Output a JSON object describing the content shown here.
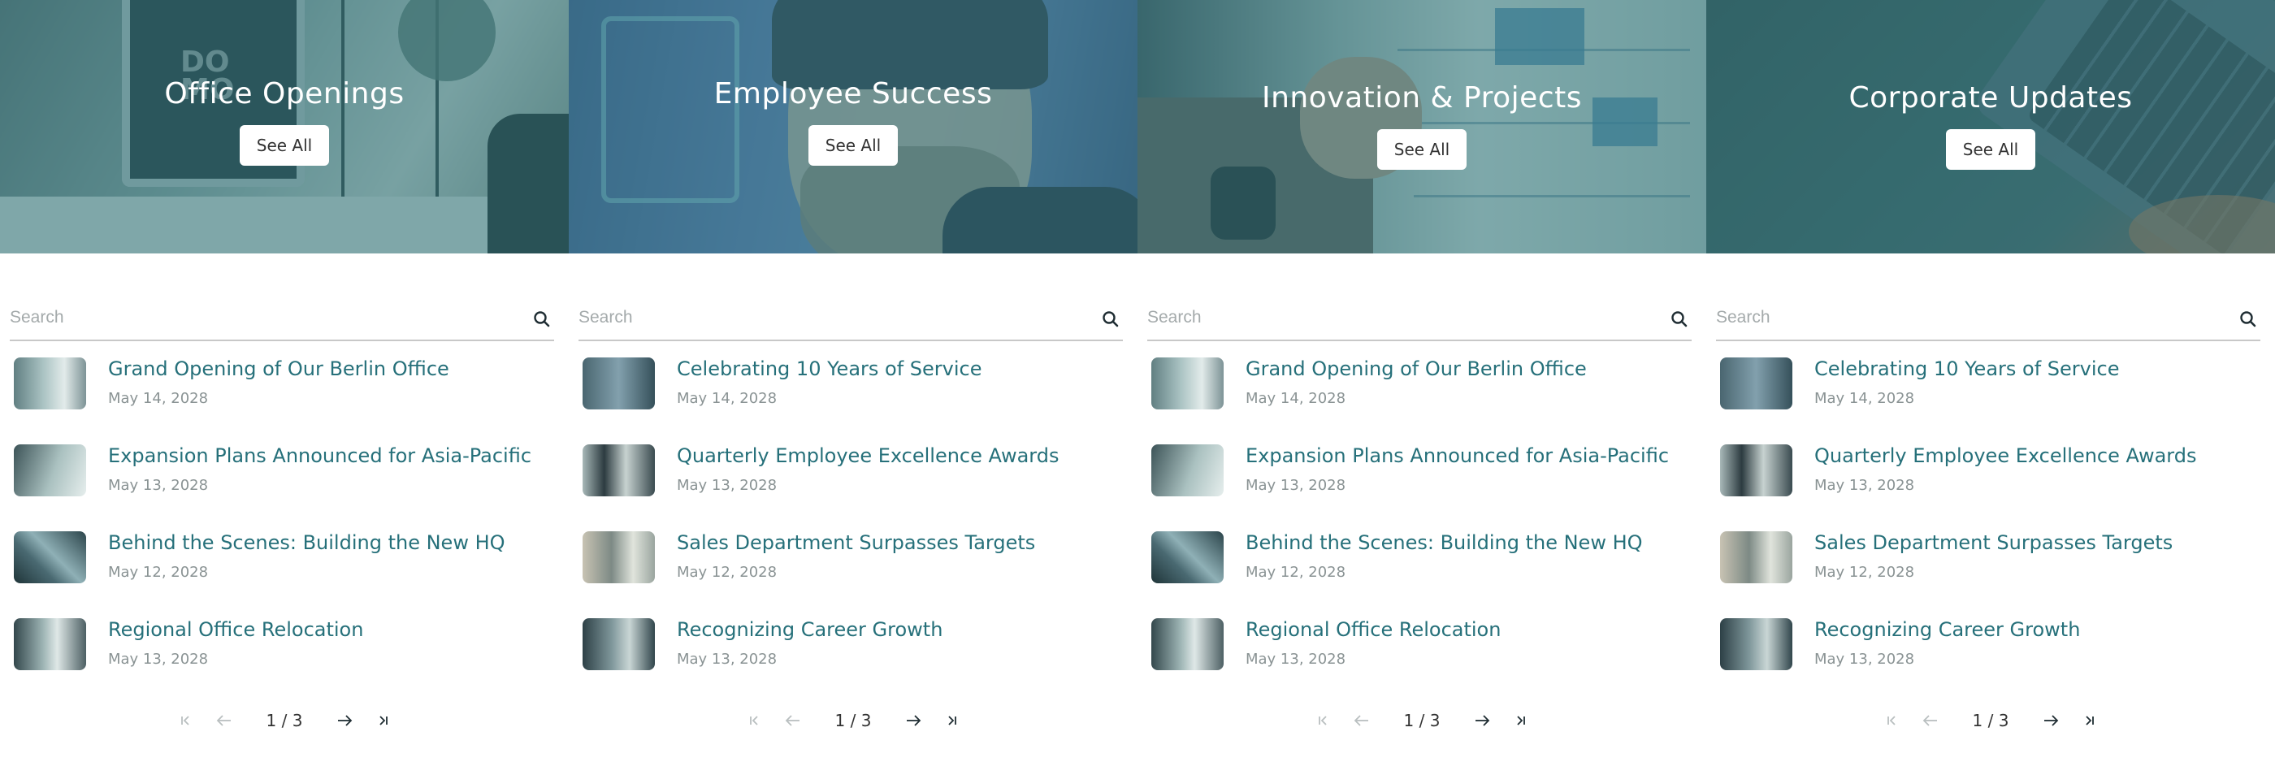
{
  "columns": [
    {
      "hero_title": "Office Openings",
      "see_all_label": "See All",
      "search_placeholder": "Search",
      "articles": [
        {
          "title": "Grand Opening of Our Berlin Office",
          "date": "May 14, 2028"
        },
        {
          "title": "Expansion Plans Announced for Asia-Pacific",
          "date": "May 13, 2028"
        },
        {
          "title": "Behind the Scenes: Building the New HQ",
          "date": "May 12, 2028"
        },
        {
          "title": "Regional Office Relocation",
          "date": "May 13, 2028"
        }
      ],
      "pagination": "1 / 3"
    },
    {
      "hero_title": "Employee Success",
      "see_all_label": "See All",
      "search_placeholder": "Search",
      "articles": [
        {
          "title": "Celebrating 10 Years of Service",
          "date": "May 14, 2028"
        },
        {
          "title": "Quarterly Employee Excellence Awards",
          "date": "May 13, 2028"
        },
        {
          "title": "Sales Department Surpasses Targets",
          "date": "May 12, 2028"
        },
        {
          "title": "Recognizing Career Growth",
          "date": "May 13, 2028"
        }
      ],
      "pagination": "1 / 3"
    },
    {
      "hero_title": "Innovation & Projects",
      "see_all_label": "See All",
      "search_placeholder": "Search",
      "articles": [
        {
          "title": "Grand Opening of Our Berlin Office",
          "date": "May 14, 2028"
        },
        {
          "title": "Expansion Plans Announced for Asia-Pacific",
          "date": "May 13, 2028"
        },
        {
          "title": "Behind the Scenes: Building the New HQ",
          "date": "May 12, 2028"
        },
        {
          "title": "Regional Office Relocation",
          "date": "May 13, 2028"
        }
      ],
      "pagination": "1 / 3"
    },
    {
      "hero_title": "Corporate Updates",
      "see_all_label": "See All",
      "search_placeholder": "Search",
      "articles": [
        {
          "title": "Celebrating 10 Years of Service",
          "date": "May 14, 2028"
        },
        {
          "title": "Quarterly Employee Excellence Awards",
          "date": "May 13, 2028"
        },
        {
          "title": "Sales Department Surpasses Targets",
          "date": "May 12, 2028"
        },
        {
          "title": "Recognizing Career Growth",
          "date": "May 13, 2028"
        }
      ],
      "pagination": "1 / 3"
    }
  ],
  "colors": {
    "accent": "#26707a",
    "hero_tint": "#34787d",
    "date_gray": "#8a9394",
    "placeholder_gray": "#a4aaab"
  },
  "icons": {
    "search": "search-icon",
    "first": "first-page-icon",
    "prev": "arrow-left-icon",
    "next": "arrow-right-icon",
    "last": "last-page-icon"
  }
}
